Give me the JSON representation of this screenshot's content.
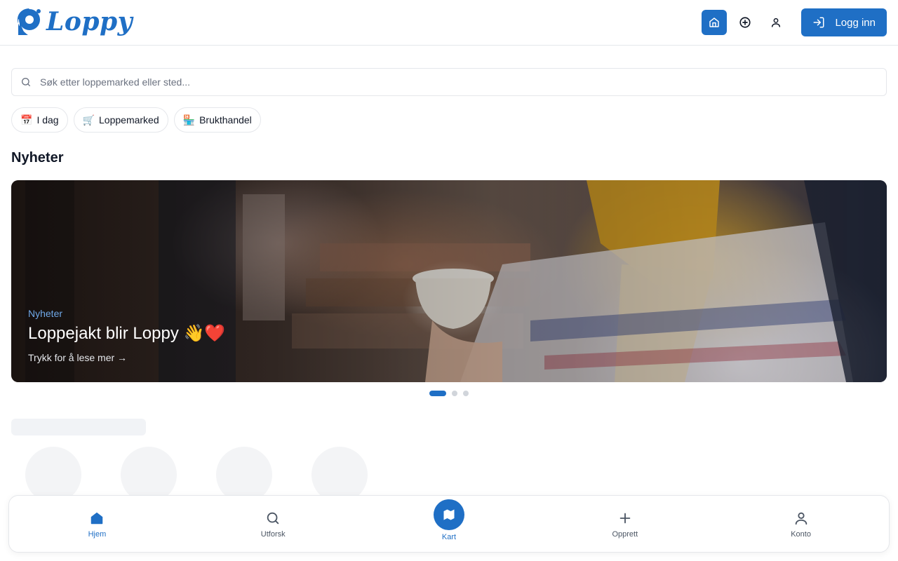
{
  "header": {
    "brand": "Loppy",
    "login_label": "Logg inn",
    "brand_color": "#1f6fc5"
  },
  "search": {
    "placeholder": "Søk etter loppemarked eller sted...",
    "value": ""
  },
  "filters": [
    {
      "emoji": "📅",
      "label": "I dag"
    },
    {
      "emoji": "🛒",
      "label": "Loppemarked"
    },
    {
      "emoji": "🏪",
      "label": "Brukthandel"
    }
  ],
  "news": {
    "section_title": "Nyheter",
    "slide": {
      "tag": "Nyheter",
      "title": "Loppejakt blir Loppy 👋❤️",
      "cta": "Trykk for å lese mer →"
    },
    "slides_count": 3,
    "active_slide": 1
  },
  "bottom_nav": [
    {
      "label": "Hjem",
      "icon": "home-icon",
      "active": true
    },
    {
      "label": "Utforsk",
      "icon": "search-icon",
      "active": false
    },
    {
      "label": "Kart",
      "icon": "map-icon",
      "active": false
    },
    {
      "label": "Opprett",
      "icon": "plus-icon",
      "active": false
    },
    {
      "label": "Konto",
      "icon": "user-icon",
      "active": false
    }
  ]
}
